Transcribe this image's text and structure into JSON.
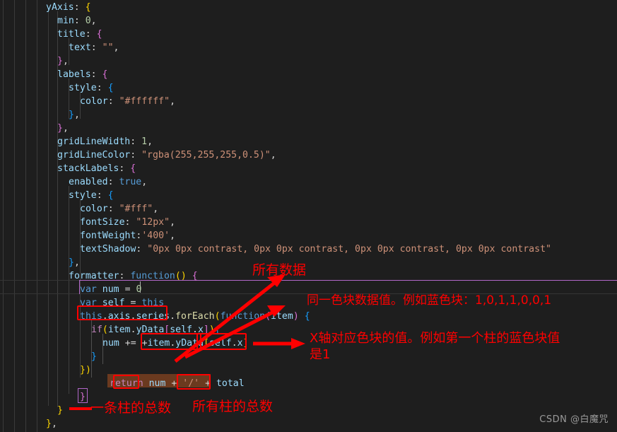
{
  "editor": {
    "language": "javascript",
    "theme": "dark-plus",
    "background": "#1e1e1e",
    "cursor_line_text": "var num = 0"
  },
  "code_lines": [
    {
      "indent": 0,
      "text": "yAxis: {"
    },
    {
      "indent": 1,
      "text": "min: 0,"
    },
    {
      "indent": 1,
      "text": "title: {"
    },
    {
      "indent": 2,
      "text": "text: \"\","
    },
    {
      "indent": 1,
      "text": "},"
    },
    {
      "indent": 1,
      "text": "labels: {"
    },
    {
      "indent": 2,
      "text": "style: {"
    },
    {
      "indent": 3,
      "text": "color: \"#ffffff\","
    },
    {
      "indent": 2,
      "text": "},"
    },
    {
      "indent": 1,
      "text": "},"
    },
    {
      "indent": 1,
      "text": "gridLineWidth: 1,"
    },
    {
      "indent": 1,
      "text": "gridLineColor: \"rgba(255,255,255,0.5)\","
    },
    {
      "indent": 1,
      "text": "stackLabels: {"
    },
    {
      "indent": 2,
      "text": "enabled: true,"
    },
    {
      "indent": 2,
      "text": "style: {"
    },
    {
      "indent": 3,
      "text": "color: \"#fff\","
    },
    {
      "indent": 3,
      "text": "fontSize: \"12px\","
    },
    {
      "indent": 3,
      "text": "fontWeight:'400',"
    },
    {
      "indent": 3,
      "text": "textShadow: \"0px 0px contrast, 0px 0px contrast, 0px 0px contrast, 0px 0px contrast\""
    },
    {
      "indent": 2,
      "text": "},"
    },
    {
      "indent": 2,
      "text": "formatter: function() {"
    },
    {
      "indent": 3,
      "text": "var num = 0"
    },
    {
      "indent": 3,
      "text": "var self = this"
    },
    {
      "indent": 3,
      "text": "this.axis.series.forEach(function(item) {"
    },
    {
      "indent": 4,
      "text": "if(item.yData[self.x]){"
    },
    {
      "indent": 5,
      "text": "num += +item.yData[self.x]"
    },
    {
      "indent": 4,
      "text": "}"
    },
    {
      "indent": 3,
      "text": "})"
    },
    {
      "indent": 3,
      "text": "return num + '/' + total"
    },
    {
      "indent": 2,
      "text": "}"
    },
    {
      "indent": 1,
      "text": "}"
    },
    {
      "indent": 0,
      "text": "},"
    }
  ],
  "highlights": {
    "boxes": [
      {
        "label": "this.axis.series"
      },
      {
        "label": "item.yData"
      },
      {
        "label": "[self.x]"
      },
      {
        "label": "num"
      },
      {
        "label": "total"
      }
    ],
    "color": "#ff0000",
    "selection_color": "#6b3a1f"
  },
  "annotations": {
    "color": "#ff0000",
    "items": [
      {
        "id": "all-data",
        "text": "所有数据"
      },
      {
        "id": "same-block",
        "text": "同一色块数据值。例如蓝色块：1,0,1,1,0,0,1"
      },
      {
        "id": "x-axis-value-1",
        "text": "X轴对应色块的值。例如第一个柱的蓝色块值"
      },
      {
        "id": "x-axis-value-2",
        "text": "是1"
      },
      {
        "id": "one-bar-total",
        "text": "一条柱的总数"
      },
      {
        "id": "all-bars-total",
        "text": "所有柱的总数"
      }
    ]
  },
  "watermark": {
    "text": "CSDN @白魔咒"
  }
}
